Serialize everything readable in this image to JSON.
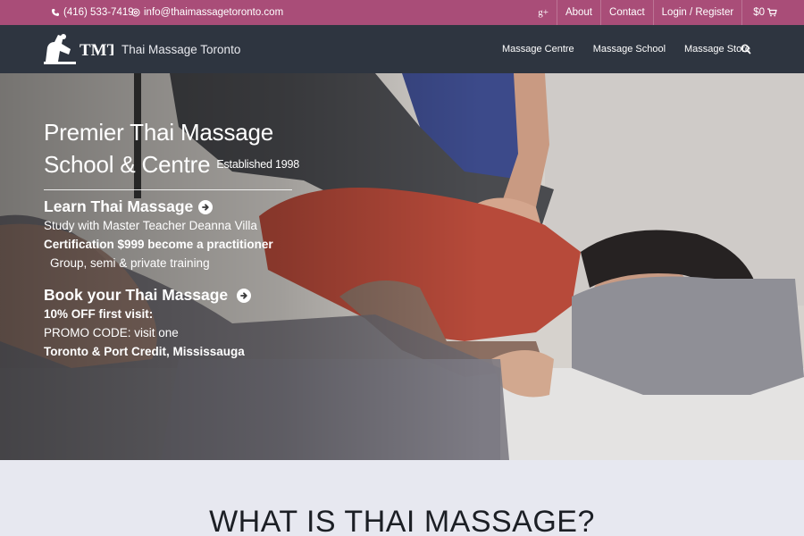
{
  "topbar": {
    "phone": "(416) 533-7419",
    "email": "info@thaimassagetoronto.com",
    "gplus": "g+",
    "links": [
      "About",
      "Contact",
      "Login / Register"
    ],
    "cart": "$0"
  },
  "nav": {
    "logo_text": "TMT",
    "brand": "Thai Massage Toronto",
    "menu": [
      "Massage Centre",
      "Massage School",
      "Massage Store"
    ]
  },
  "hero": {
    "title_line1": "Premier Thai Massage",
    "title_line2": "School & Centre",
    "established": "Established 1998",
    "learn": {
      "heading": "Learn Thai Massage",
      "line1": "Study with Master Teacher Deanna Villa",
      "line2": "Certification $999  become a practitioner",
      "line3": "Group, semi & private training"
    },
    "book": {
      "heading": "Book your Thai Massage",
      "line1": "10% OFF first visit:",
      "line2": "PROMO CODE: visit one",
      "line3": "Toronto & Port Credit, Mississauga"
    }
  },
  "section": {
    "title": "WHAT IS THAI MASSAGE?"
  },
  "colors": {
    "topbar": "#a94d78",
    "nav": "#2e3540",
    "section_bg": "#e7e8f0"
  }
}
